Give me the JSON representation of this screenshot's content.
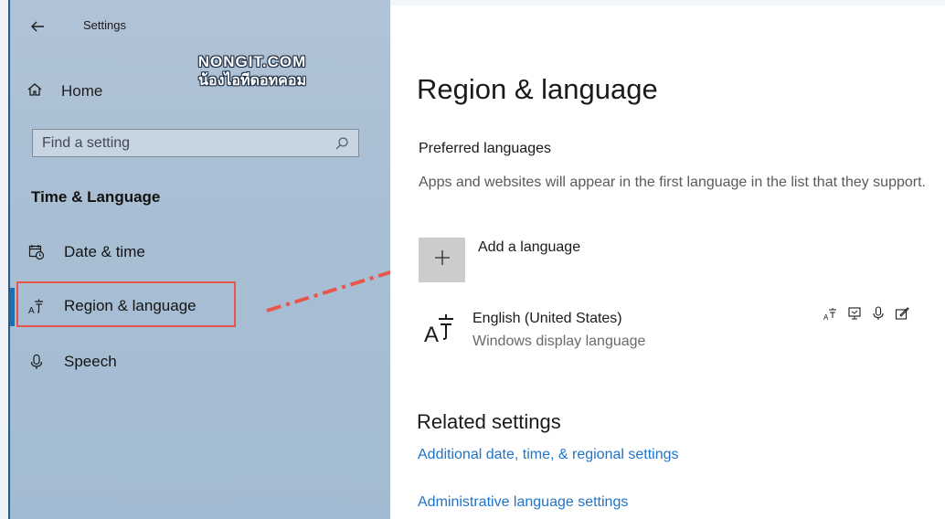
{
  "app": {
    "title": "Settings"
  },
  "watermark": {
    "line1": "NONGIT.COM",
    "line2": "น้องไอทีดอทคอม"
  },
  "sidebar": {
    "home_label": "Home",
    "search_placeholder": "Find a setting",
    "section_title": "Time & Language",
    "items": [
      {
        "label": "Date & time",
        "icon": "calendar-clock-icon"
      },
      {
        "label": "Region & language",
        "icon": "language-icon",
        "selected": true
      },
      {
        "label": "Speech",
        "icon": "microphone-icon"
      }
    ]
  },
  "main": {
    "page_title": "Region & language",
    "preferred_title": "Preferred languages",
    "preferred_desc": "Apps and websites will appear in the first language in the list that they support.",
    "add_language_label": "Add a language",
    "language": {
      "name": "English (United States)",
      "subtitle": "Windows display language",
      "capabilities": [
        "language-pack-icon",
        "display-icon",
        "speech-icon",
        "handwriting-icon"
      ]
    },
    "related_title": "Related settings",
    "links": [
      "Additional date, time, & regional settings",
      "Administrative language settings"
    ]
  },
  "colors": {
    "sidebar_bg": "#a8bed3",
    "accent": "#1a6fb8",
    "link": "#1f74c9",
    "annotation": "#e9554a"
  }
}
